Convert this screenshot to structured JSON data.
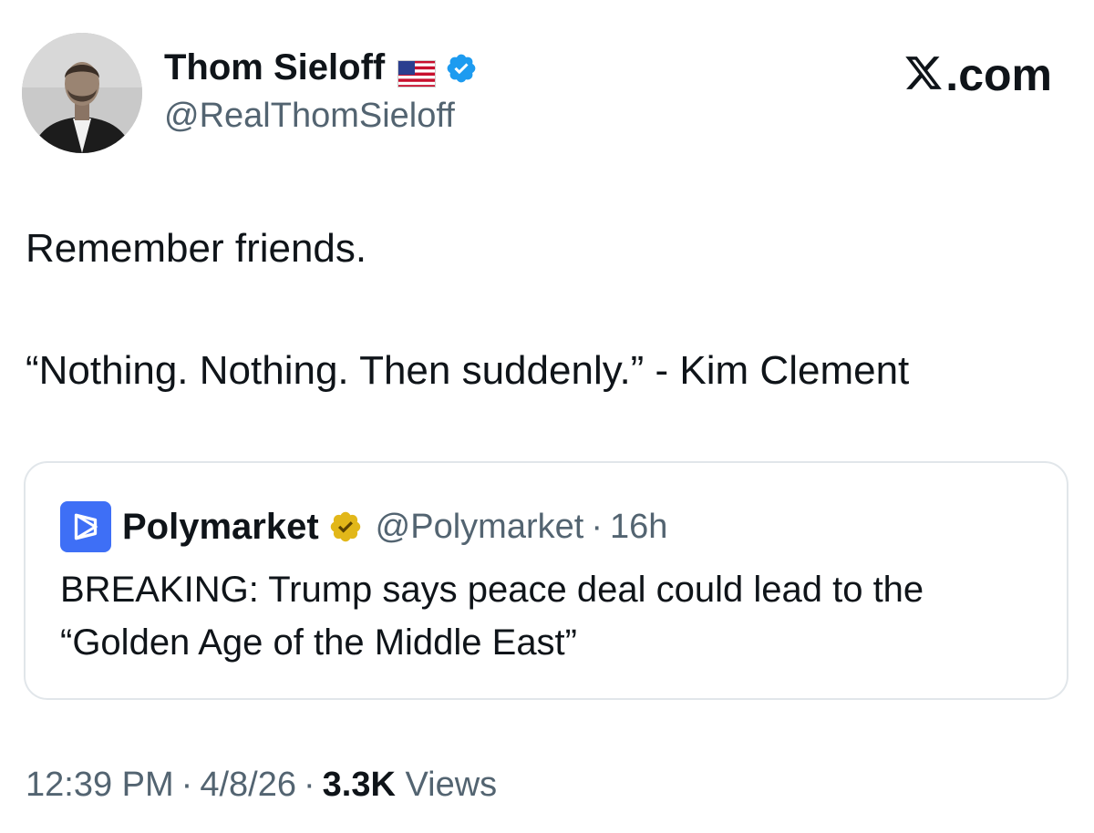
{
  "author": {
    "display_name": "Thom Sieloff",
    "handle": "@RealThomSieloff",
    "flag_icon": "us-flag-icon",
    "verified_icon": "blue-verified-badge-icon",
    "verified_color": "#1d9bf0"
  },
  "brand": {
    "logo_icon": "x-logo-icon",
    "label": ".com"
  },
  "tweet": {
    "line1": "Remember friends.",
    "line2": "“Nothing. Nothing. Then suddenly.” - Kim Clement"
  },
  "quoted_tweet": {
    "name": "Polymarket",
    "logo_icon": "polymarket-logo-icon",
    "logo_color": "#3e6ff6",
    "badge_icon": "gold-verified-badge-icon",
    "badge_color": "#e2b719",
    "handle": "@Polymarket",
    "separator": "·",
    "time": "16h",
    "body_line1": "BREAKING: Trump says peace deal could lead to the",
    "body_line2": "“Golden Age of the Middle East”"
  },
  "meta": {
    "time": "12:39 PM",
    "separator": "·",
    "date": "4/8/26",
    "views_count": "3.3K",
    "views_label": "Views"
  }
}
